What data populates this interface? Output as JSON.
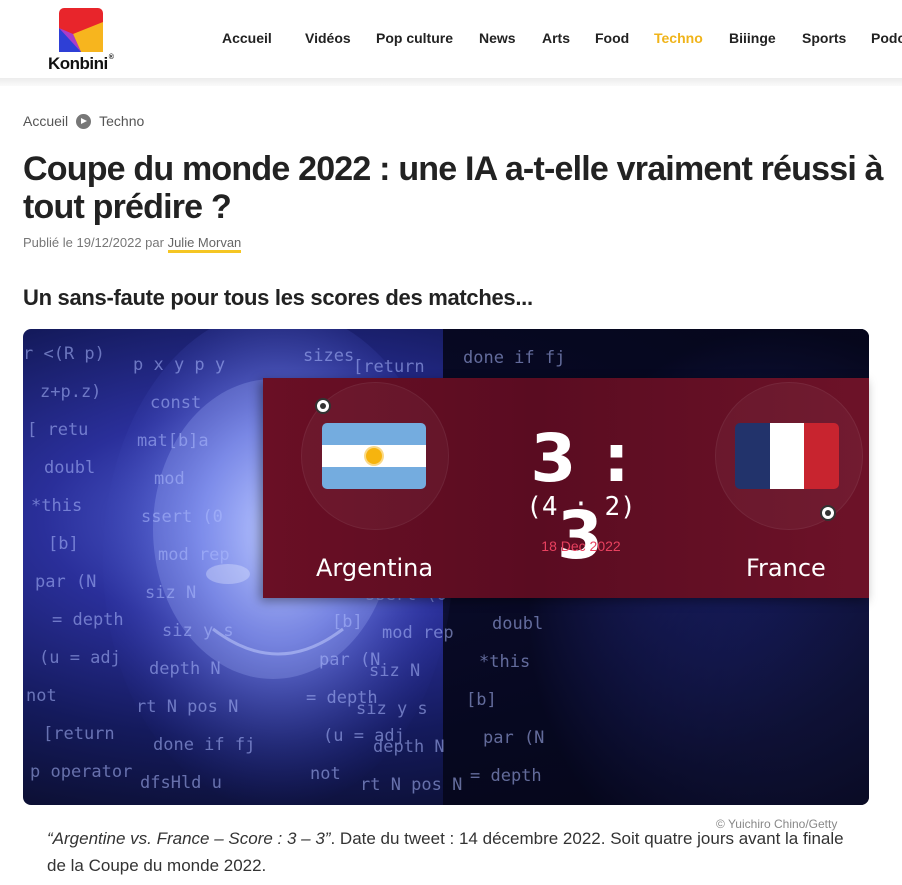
{
  "logo": {
    "name": "Konbini",
    "reg": "®",
    "colors": {
      "red": "#e8252b",
      "yellow": "#f7b51e",
      "blue": "#2e3fd6"
    }
  },
  "nav": {
    "items": [
      {
        "label": "Accueil"
      },
      {
        "label": "Vidéos"
      },
      {
        "label": "Pop culture"
      },
      {
        "label": "News"
      },
      {
        "label": "Arts"
      },
      {
        "label": "Food"
      },
      {
        "label": "Techno",
        "active": true
      },
      {
        "label": "Biiinge"
      },
      {
        "label": "Sports"
      },
      {
        "label": "Podcasts"
      }
    ],
    "active_color": "#f0b41a"
  },
  "breadcrumb": {
    "home": "Accueil",
    "current": "Techno"
  },
  "article": {
    "title": "Coupe du monde 2022 : une IA a-t-elle vraiment réussi à tout prédire ?",
    "meta_prefix": "Publié le 19/12/2022 par",
    "author": "Julie Morvan",
    "subtitle": "Un sans-faute pour tous les scores des matches...",
    "image_credit": "© Yuichiro Chino/Getty",
    "caption_quote": "“Argentine vs. France – Score : 3 – 3”",
    "caption_rest": ". Date du tweet : 14 décembre 2022. Soit quatre jours avant la finale de la Coupe du monde 2022."
  },
  "scoreboard": {
    "team_left": "Argentina",
    "team_right": "France",
    "score": "3 : 3",
    "penalties": "(4 : 2)",
    "date": "18 Dec 2022",
    "panel_color": "#5a0c21",
    "date_color": "#e8415f"
  },
  "hero_code_text": [
    "r <(R p)",
    "z+p.z)",
    "[ retu",
    "doubl",
    "*this",
    "[b]",
    "par (N",
    "= depth",
    "(u = adj",
    "not",
    "[return",
    "p operator",
    "p x y p y",
    "const",
    "mat[b]a",
    "mod",
    "ssert (0",
    "mod rep",
    "siz N",
    "siz y s",
    "depth N",
    "rt N pos N",
    "done if fj",
    "dfsHld u",
    "sizes",
    "pos"
  ]
}
